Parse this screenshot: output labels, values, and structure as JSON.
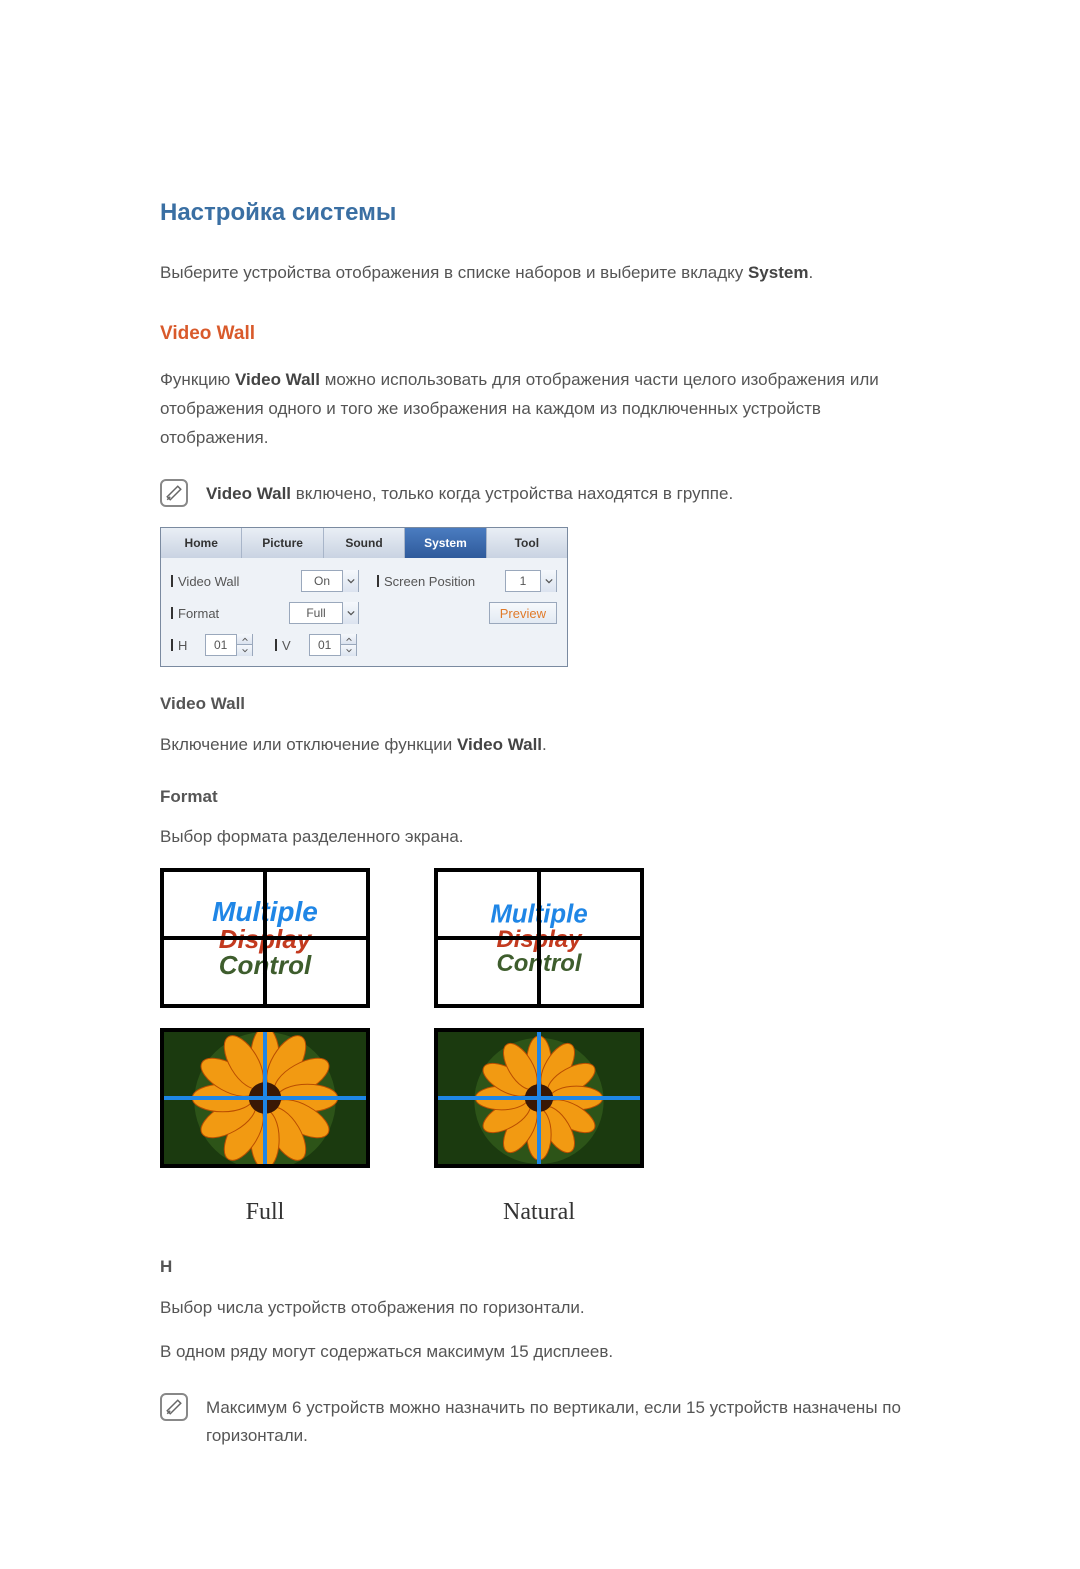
{
  "headings": {
    "h2_system_setup": "Настройка системы",
    "h3_video_wall": "Video Wall",
    "h4_video_wall": "Video Wall",
    "h4_format": "Format",
    "h4_h": "H"
  },
  "paragraphs": {
    "intro_prefix": "Выберите устройства отображения в списке наборов и выберите вкладку ",
    "intro_bold": "System",
    "intro_suffix": ".",
    "videowall_desc_prefix": "Функцию ",
    "videowall_desc_bold": "Video Wall",
    "videowall_desc_suffix": " можно использовать для отображения части целого изображения или отображения одного и того же изображения на каждом из подключенных устройств отображения.",
    "videowall_toggle_prefix": "Включение или отключение функции ",
    "videowall_toggle_bold": "Video Wall",
    "videowall_toggle_suffix": ".",
    "format_desc": "Выбор формата разделенного экрана.",
    "h_desc": "Выбор числа устройств отображения по горизонтали.",
    "h_max_row": "В одном ряду могут содержаться максимум 15 дисплеев."
  },
  "notes": {
    "note1_prefix": "Video Wall",
    "note1_text": " включено, только когда устройства находятся в группе.",
    "note2": "Максимум 6 устройств можно назначить по вертикали, если 15 устройств назначены по горизонтали."
  },
  "panel": {
    "tabs": {
      "home": "Home",
      "picture": "Picture",
      "sound": "Sound",
      "system": "System",
      "tool": "Tool"
    },
    "fields": {
      "video_wall_label": "Video Wall",
      "video_wall_value": "On",
      "screen_position_label": "Screen Position",
      "screen_position_value": "1",
      "format_label": "Format",
      "format_value": "Full",
      "preview_label": "Preview",
      "h_label": "H",
      "h_value": "01",
      "v_label": "V",
      "v_value": "01"
    }
  },
  "format_labels": {
    "full": "Full",
    "natural": "Natural"
  },
  "mdc": {
    "line1": "Multiple",
    "line2": "Display",
    "line3": "Control"
  }
}
